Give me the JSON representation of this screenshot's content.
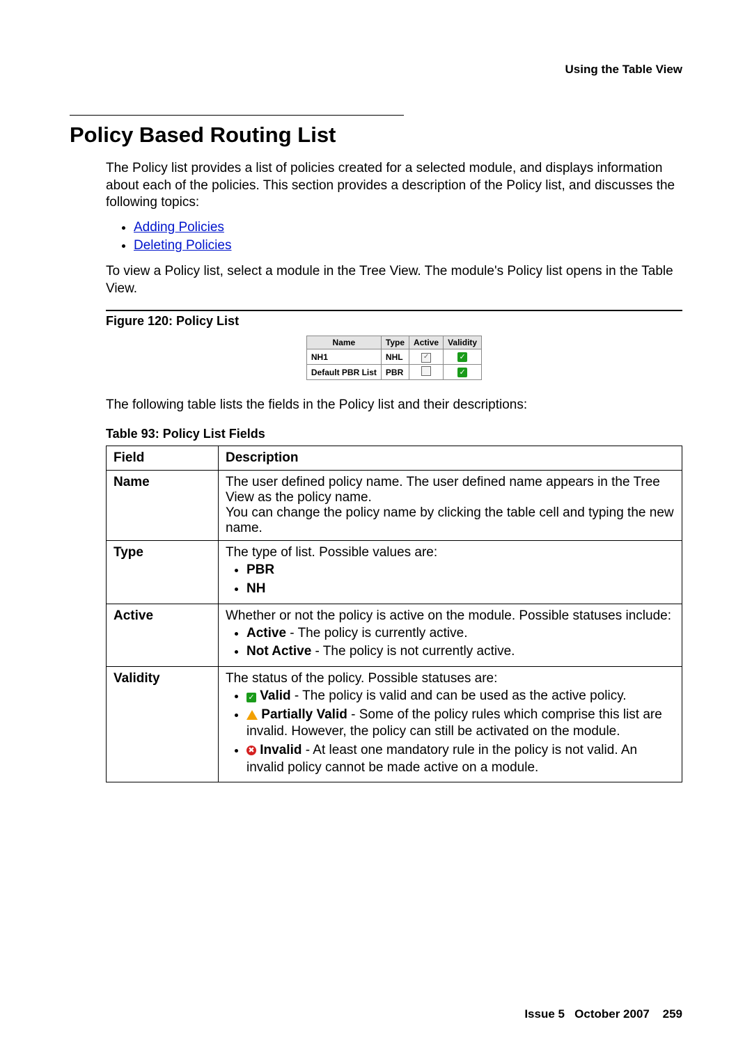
{
  "running_head": "Using the Table View",
  "heading": "Policy Based Routing List",
  "intro": "The Policy list provides a list of policies created for a selected module, and displays information about each of the policies. This section provides a description of the Policy list, and discusses the following topics:",
  "links": {
    "add": "Adding Policies",
    "del": "Deleting Policies"
  },
  "para2": "To view a Policy list, select a module in the Tree View. The module's Policy list opens in the Table View.",
  "figure_caption": "Figure 120: Policy List",
  "figure": {
    "headers": {
      "name": "Name",
      "type": "Type",
      "active": "Active",
      "validity": "Validity"
    },
    "rows": [
      {
        "name": "NH1",
        "type": "NHL",
        "active": true
      },
      {
        "name": "Default PBR List",
        "type": "PBR",
        "active": false
      }
    ]
  },
  "para3": "The following table lists the fields in the Policy list and their descriptions:",
  "table_caption": "Table 93: Policy List Fields",
  "fields_table": {
    "headers": {
      "field": "Field",
      "desc": "Description"
    },
    "rows": {
      "name": {
        "label": "Name",
        "l1": "The user defined policy name. The user defined name appears in the Tree View as the policy name.",
        "l2": "You can change the policy name by clicking the table cell and typing the new name."
      },
      "type": {
        "label": "Type",
        "intro": "The type of list. Possible values are:",
        "v1": "PBR",
        "v2": "NH"
      },
      "active": {
        "label": "Active",
        "intro": "Whether or not the policy is active on the module. Possible statuses include:",
        "s1b": "Active",
        "s1t": " - The policy is currently active.",
        "s2b": "Not Active",
        "s2t": " - The policy is not currently active."
      },
      "validity": {
        "label": "Validity",
        "intro": "The status of the policy. Possible statuses are:",
        "vb": "Valid",
        "vt": " - The policy is valid and can be used as the active policy.",
        "pb": "Partially Valid",
        "pt": " - Some of the policy rules which comprise this list are invalid. However, the policy can still be activated on the module.",
        "ib": "Invalid",
        "it": " - At least one mandatory rule in the policy is not valid. An invalid policy cannot be made active on a module."
      }
    }
  },
  "footer": {
    "issue": "Issue 5",
    "date": "October 2007",
    "page": "259"
  }
}
